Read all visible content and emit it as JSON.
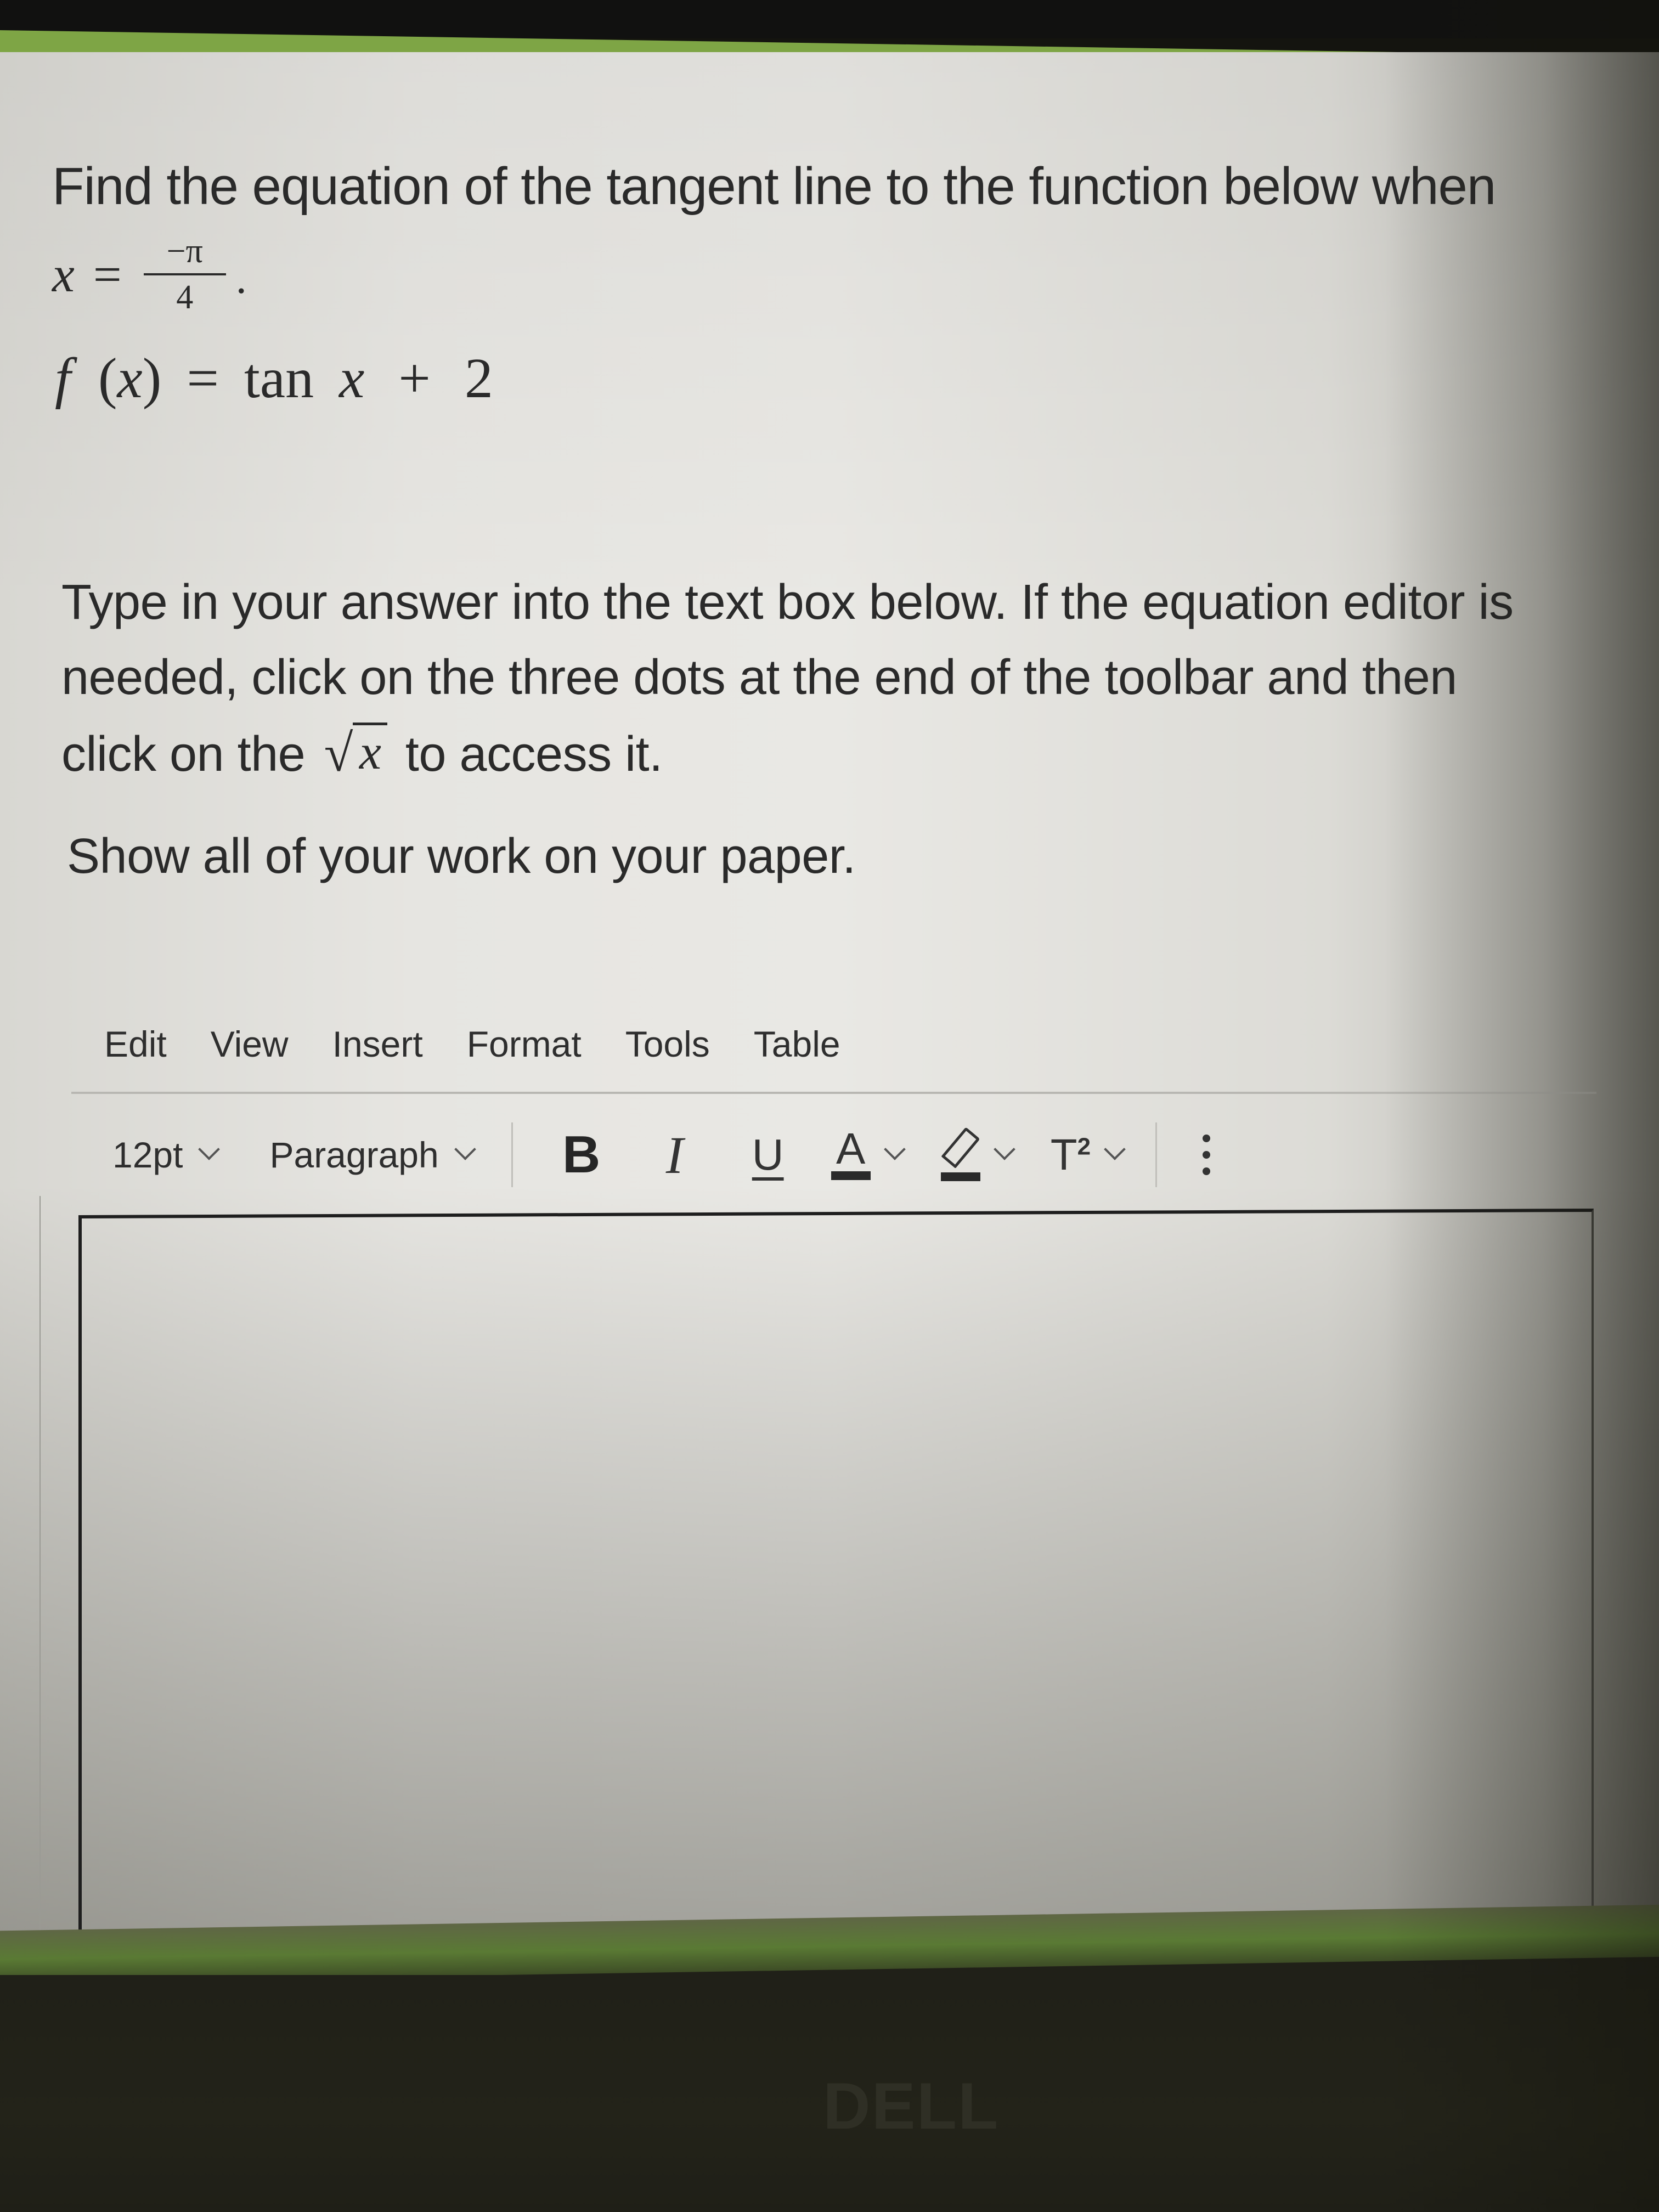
{
  "question": {
    "prompt": "Find the equation of the tangent line to the function below when",
    "x_value": {
      "variable": "x",
      "equals": "=",
      "numerator": "−π",
      "denominator": "4",
      "terminator": "."
    },
    "function": {
      "lhs_name": "f",
      "lhs_open": "(",
      "lhs_var": "x",
      "lhs_close": ")",
      "equals": "=",
      "rhs_func": "tan",
      "rhs_var": "x",
      "rhs_plus": "+",
      "rhs_const": "2"
    }
  },
  "instructions": {
    "line1": "Type in your answer into the text box below. If the equation editor is",
    "line2": "needed, click on the three dots at the end of the toolbar and then",
    "line3_before": "click on the",
    "sqrt_radicand": "x",
    "line3_after": "to access it.",
    "show_work": "Show all of your work on your paper."
  },
  "editor": {
    "menu": [
      {
        "label": "Edit"
      },
      {
        "label": "View"
      },
      {
        "label": "Insert"
      },
      {
        "label": "Format"
      },
      {
        "label": "Tools"
      },
      {
        "label": "Table"
      }
    ],
    "toolbar": {
      "font_size": "12pt",
      "block_format": "Paragraph",
      "bold": "B",
      "italic": "I",
      "underline": "U",
      "text_color": "A",
      "superscript_base": "T",
      "superscript_exp": "2",
      "icons": {
        "font_size_dropdown": "chevron-down-icon",
        "block_dropdown": "chevron-down-icon",
        "text_color": "text-color-icon",
        "highlight": "highlighter-icon",
        "superscript": "superscript-icon",
        "more": "more-vertical-icon"
      }
    },
    "content": ""
  },
  "monitor": {
    "brand": "DELL"
  },
  "colors": {
    "accent_green": "#7ea545",
    "page_bg": "#e6e5e1",
    "text": "#2a2a2a"
  }
}
